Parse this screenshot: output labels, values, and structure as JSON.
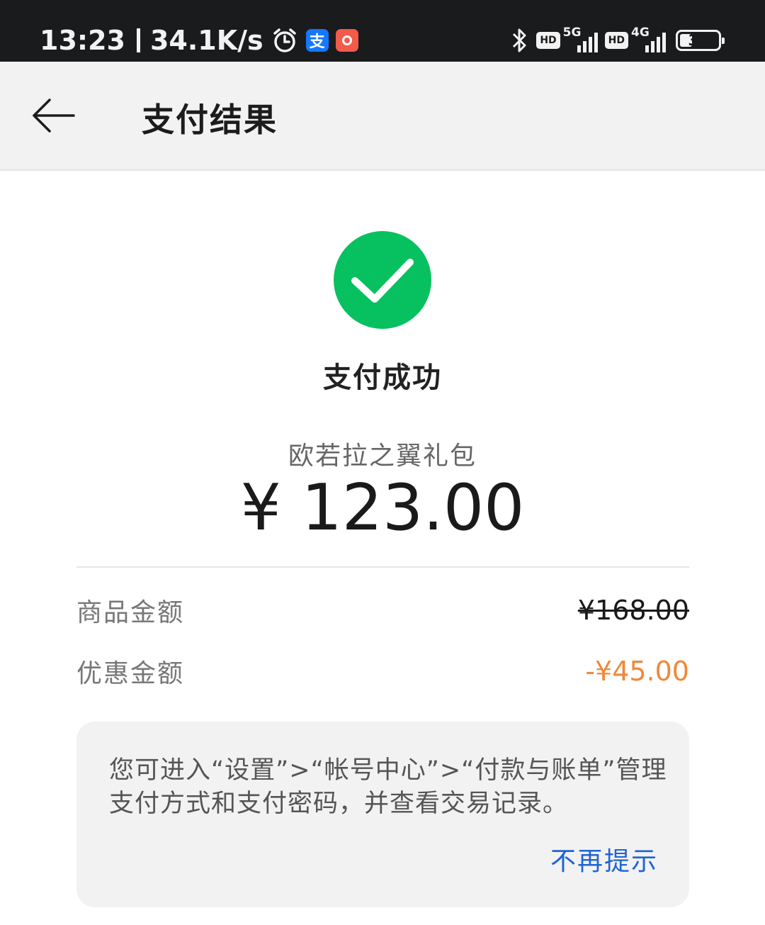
{
  "status_bar": {
    "time": "13:23",
    "speed": "34.1K/s",
    "icons": [
      "alarm-icon",
      "alipay-icon",
      "watch-app-icon",
      "bluetooth-icon",
      "hd-icon",
      "signal-5g-icon",
      "hd-icon",
      "signal-4g-icon",
      "battery-icon"
    ],
    "hd_label": "HD",
    "net1_label": "5G",
    "net2_label": "4G",
    "alipay_glyph": "支",
    "battery_level": 32,
    "battery_text": "32"
  },
  "header": {
    "title": "支付结果",
    "back_icon": "arrow-left-icon"
  },
  "result": {
    "status_text": "支付成功",
    "product_name": "欧若拉之翼礼包",
    "amount": "¥ 123.00",
    "accent_color": "#07c160"
  },
  "details": [
    {
      "label": "商品金额",
      "value": "¥168.00"
    },
    {
      "label": "优惠金额",
      "value": "-¥45.00",
      "color": "#f0883a"
    }
  ],
  "info_card": {
    "text": "您可进入“设置”>“帐号中心”>“付款与账单”管理支付方式和支付密码，并查看交易记录。",
    "dismiss_label": "不再提示",
    "link_color": "#1f64d4"
  }
}
